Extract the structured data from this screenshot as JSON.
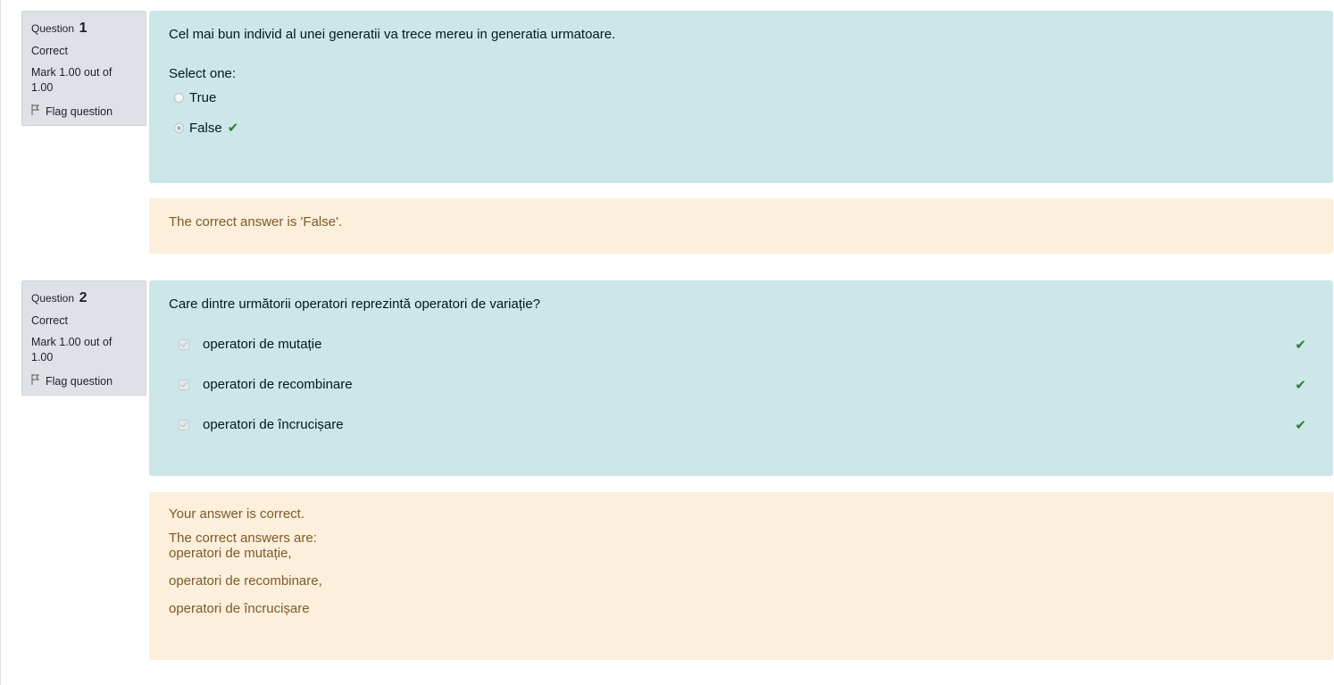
{
  "questions": [
    {
      "label": "Question",
      "number": "1",
      "state": "Correct",
      "grade": "Mark 1.00 out of 1.00",
      "flag_label": "Flag question",
      "text": "Cel mai bun individ al unei generatii va trece mereu in generatia urmatoare.",
      "prompt": "Select one:",
      "options": [
        {
          "label": "True",
          "selected": false,
          "correct": false
        },
        {
          "label": "False",
          "selected": true,
          "correct": true
        }
      ],
      "feedback": "The correct answer is 'False'."
    },
    {
      "label": "Question",
      "number": "2",
      "state": "Correct",
      "grade": "Mark 1.00 out of 1.00",
      "flag_label": "Flag question",
      "text": "Care dintre următorii operatori reprezintă operatori de variație?",
      "options": [
        {
          "label": "operatori de mutație",
          "checked": true,
          "correct": true
        },
        {
          "label": "operatori de recombinare",
          "checked": true,
          "correct": true
        },
        {
          "label": "operatori de încrucișare",
          "checked": true,
          "correct": true
        }
      ],
      "feedback_summary": "Your answer is correct.",
      "feedback_heading": "The correct answers are:",
      "feedback_answers": [
        "operatori de mutație,",
        "operatori de recombinare,",
        "operatori de încrucișare"
      ]
    }
  ],
  "icons": {
    "check": "check-icon",
    "flag": "flag-icon"
  },
  "colors": {
    "formulation_bg": "#cce6ea",
    "feedback_bg": "#fcefdc",
    "correct": "#2e7d32"
  }
}
